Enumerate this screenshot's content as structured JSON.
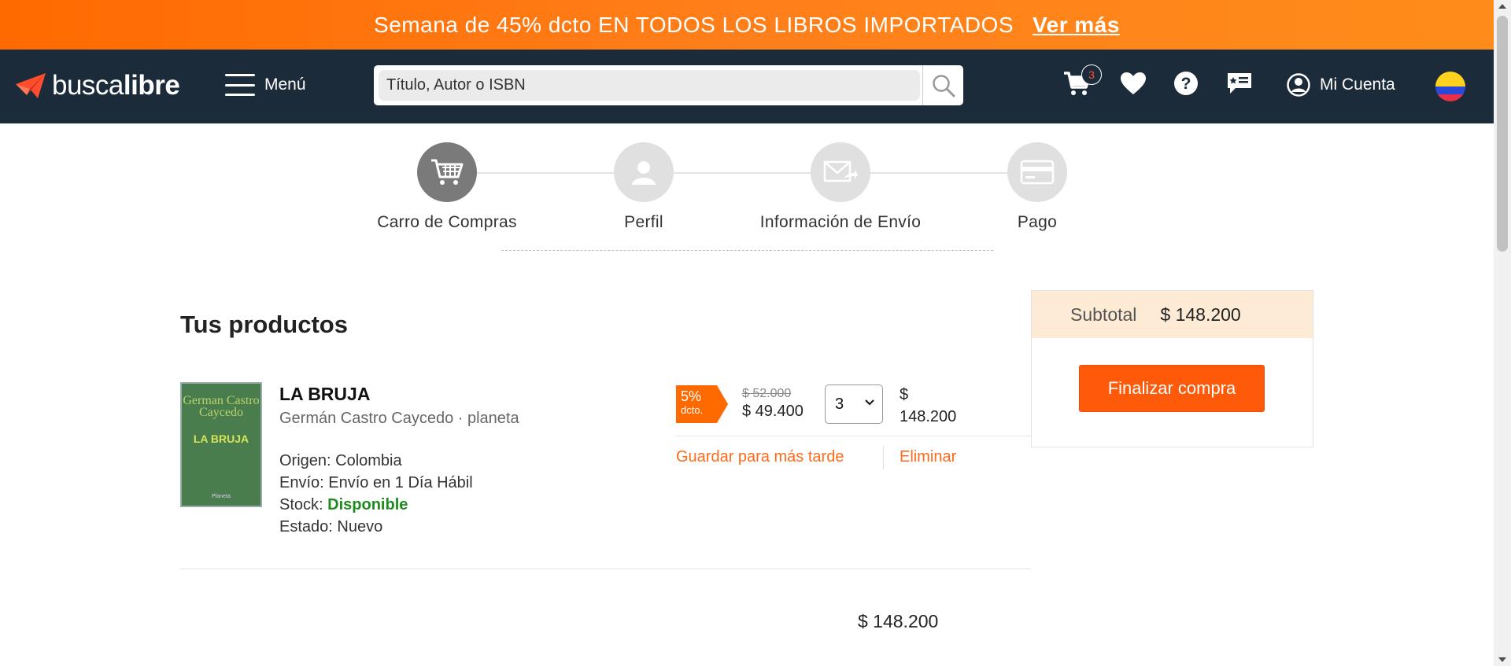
{
  "promo": {
    "text": "Semana de 45% dcto EN TODOS LOS LIBROS IMPORTADOS",
    "link": "Ver más"
  },
  "header": {
    "logo_part1": "busca",
    "logo_part2": "libre",
    "menu_label": "Menú",
    "search_placeholder": "Título, Autor o ISBN",
    "cart_count": "3",
    "account_label": "Mi Cuenta"
  },
  "steps": [
    {
      "label": "Carro de Compras",
      "icon": "cart-icon",
      "active": true
    },
    {
      "label": "Perfil",
      "icon": "user-icon",
      "active": false
    },
    {
      "label": "Información de Envío",
      "icon": "mail-send-icon",
      "active": false
    },
    {
      "label": "Pago",
      "icon": "credit-card-icon",
      "active": false
    }
  ],
  "products": {
    "title": "Tus productos",
    "items": [
      {
        "cover_author": "German Castro Caycedo",
        "cover_title": "LA BRUJA",
        "cover_publisher": "Planeta",
        "name": "LA BRUJA",
        "subtitle": "Germán Castro Caycedo · planeta",
        "origin_label": "Origen: Colombia",
        "shipping_label": "Envío: Envío en 1 Día Hábil",
        "stock_label": "Stock: ",
        "stock_value": "Disponible",
        "status_label": "Estado: Nuevo",
        "discount_pct": "5%",
        "discount_word": "dcto.",
        "old_price": "$ 52.000",
        "new_price": "$ 49.400",
        "quantity": "3",
        "line_total_currency": "$",
        "line_total_value": "148.200",
        "save_later": "Guardar para más tarde",
        "delete": "Eliminar"
      }
    ],
    "total": "$ 148.200"
  },
  "summary": {
    "subtotal_label": "Subtotal",
    "subtotal_value": "$ 148.200",
    "checkout_label": "Finalizar compra"
  },
  "colors": {
    "brand_orange": "#ff5a0a",
    "header_navy": "#1c2b3a",
    "stock_green": "#1f8a1f"
  }
}
